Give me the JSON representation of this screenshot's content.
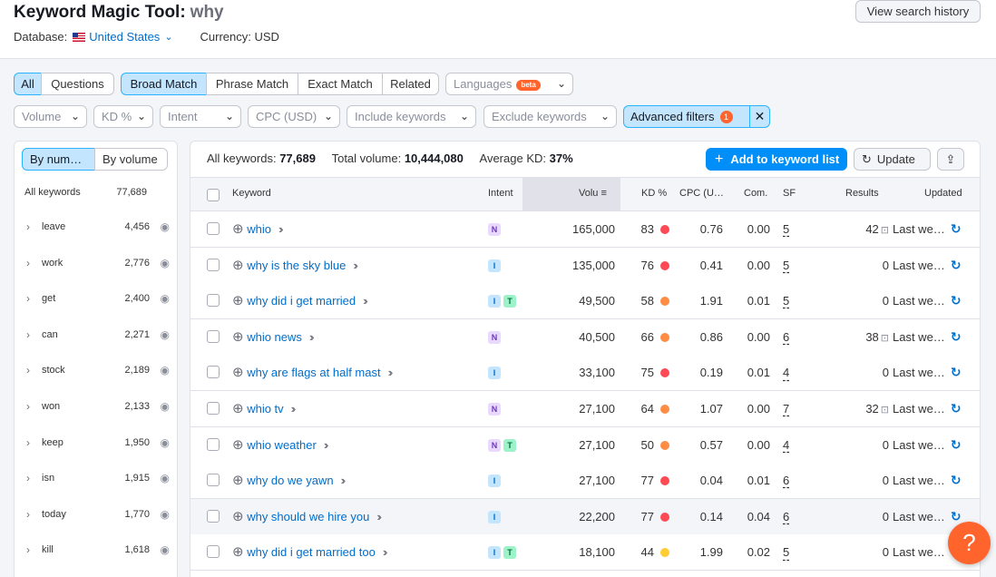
{
  "header": {
    "title": "Keyword Magic Tool:",
    "query": "why",
    "database_label": "Database:",
    "database_value": "United States",
    "currency": "Currency: USD",
    "history_button": "View search history"
  },
  "tabs_match": {
    "all": "All",
    "questions": "Questions",
    "broad": "Broad Match",
    "phrase": "Phrase Match",
    "exact": "Exact Match",
    "related": "Related"
  },
  "languages": {
    "label": "Languages",
    "badge": "beta"
  },
  "filters": {
    "volume": "Volume",
    "kd": "KD %",
    "intent": "Intent",
    "cpc": "CPC (USD)",
    "include": "Include keywords",
    "exclude": "Exclude keywords",
    "advanced": "Advanced filters",
    "advanced_count": "1"
  },
  "sidebar": {
    "by_number": "By num…",
    "by_volume": "By volume",
    "all_label": "All keywords",
    "all_count": "77,689",
    "items": [
      {
        "word": "leave",
        "count": "4,456"
      },
      {
        "word": "work",
        "count": "2,776"
      },
      {
        "word": "get",
        "count": "2,400"
      },
      {
        "word": "can",
        "count": "2,271"
      },
      {
        "word": "stock",
        "count": "2,189"
      },
      {
        "word": "won",
        "count": "2,133"
      },
      {
        "word": "keep",
        "count": "1,950"
      },
      {
        "word": "isn",
        "count": "1,915"
      },
      {
        "word": "today",
        "count": "1,770"
      },
      {
        "word": "kill",
        "count": "1,618"
      }
    ]
  },
  "summary": {
    "all_label": "All keywords:",
    "all_value": "77,689",
    "vol_label": "Total volume:",
    "vol_value": "10,444,080",
    "kd_label": "Average KD:",
    "kd_value": "37%"
  },
  "actions": {
    "add_list": "Add to keyword list",
    "update": "Update"
  },
  "columns": {
    "keyword": "Keyword",
    "intent": "Intent",
    "volume": "Volu",
    "kd": "KD %",
    "cpc": "CPC (U…",
    "com": "Com.",
    "sf": "SF",
    "results": "Results",
    "updated": "Updated"
  },
  "rows": [
    {
      "keyword": "whio",
      "intents": [
        "N"
      ],
      "volume": "165,000",
      "kd": "83",
      "kd_color": "#ff4953",
      "cpc": "0.76",
      "com": "0.00",
      "sf": "5",
      "results": "42",
      "serp": true,
      "updated": "Last we…"
    },
    {
      "keyword": "why is the sky blue",
      "intents": [
        "I"
      ],
      "volume": "135,000",
      "kd": "76",
      "kd_color": "#ff4953",
      "cpc": "0.41",
      "com": "0.00",
      "sf": "5",
      "results": "0",
      "serp": false,
      "updated": "Last we…"
    },
    {
      "keyword": "why did i get married",
      "intents": [
        "I",
        "T"
      ],
      "volume": "49,500",
      "kd": "58",
      "kd_color": "#ff8c43",
      "cpc": "1.91",
      "com": "0.01",
      "sf": "5",
      "results": "0",
      "serp": false,
      "updated": "Last we…"
    },
    {
      "keyword": "whio news",
      "intents": [
        "N"
      ],
      "volume": "40,500",
      "kd": "66",
      "kd_color": "#ff8c43",
      "cpc": "0.86",
      "com": "0.00",
      "sf": "6",
      "results": "38",
      "serp": true,
      "updated": "Last we…"
    },
    {
      "keyword": "why are flags at half mast",
      "intents": [
        "I"
      ],
      "volume": "33,100",
      "kd": "75",
      "kd_color": "#ff4953",
      "cpc": "0.19",
      "com": "0.01",
      "sf": "4",
      "results": "0",
      "serp": false,
      "updated": "Last we…"
    },
    {
      "keyword": "whio tv",
      "intents": [
        "N"
      ],
      "volume": "27,100",
      "kd": "64",
      "kd_color": "#ff8c43",
      "cpc": "1.07",
      "com": "0.00",
      "sf": "7",
      "results": "32",
      "serp": true,
      "updated": "Last we…"
    },
    {
      "keyword": "whio weather",
      "intents": [
        "N",
        "T"
      ],
      "volume": "27,100",
      "kd": "50",
      "kd_color": "#ff8c43",
      "cpc": "0.57",
      "com": "0.00",
      "sf": "4",
      "results": "0",
      "serp": false,
      "updated": "Last we…"
    },
    {
      "keyword": "why do we yawn",
      "intents": [
        "I"
      ],
      "volume": "27,100",
      "kd": "77",
      "kd_color": "#ff4953",
      "cpc": "0.04",
      "com": "0.01",
      "sf": "6",
      "results": "0",
      "serp": false,
      "updated": "Last we…"
    },
    {
      "keyword": "why should we hire you",
      "intents": [
        "I"
      ],
      "volume": "22,200",
      "kd": "77",
      "kd_color": "#ff4953",
      "cpc": "0.14",
      "com": "0.04",
      "sf": "6",
      "results": "0",
      "serp": false,
      "updated": "Last we…"
    },
    {
      "keyword": "why did i get married too",
      "intents": [
        "I",
        "T"
      ],
      "volume": "18,100",
      "kd": "44",
      "kd_color": "#ffcc33",
      "cpc": "1.99",
      "com": "0.02",
      "sf": "5",
      "results": "0",
      "serp": false,
      "updated": "Last we…"
    }
  ],
  "help": {
    "label": "?"
  }
}
